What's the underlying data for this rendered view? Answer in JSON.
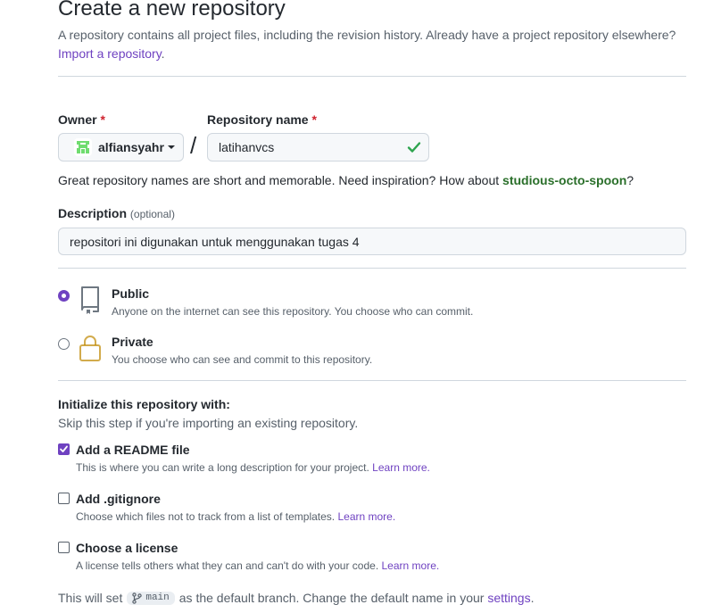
{
  "header": {
    "title": "Create a new repository",
    "subtitle": "A repository contains all project files, including the revision history. Already have a project repository elsewhere?",
    "import_link": "Import a repository",
    "import_link_suffix": "."
  },
  "owner": {
    "label": "Owner",
    "required_mark": "*",
    "value": "alfiansyahr"
  },
  "slash": "/",
  "repo_name": {
    "label": "Repository name",
    "required_mark": "*",
    "value": "latihanvcs"
  },
  "name_hint": {
    "text": "Great repository names are short and memorable. Need inspiration? How about ",
    "suggestion": "studious-octo-spoon",
    "suffix": "?"
  },
  "description": {
    "label": "Description",
    "optional": "(optional)",
    "value": "repositori ini digunakan untuk menggunakan tugas 4"
  },
  "visibility": {
    "selected": "public",
    "public": {
      "title": "Public",
      "desc": "Anyone on the internet can see this repository. You choose who can commit."
    },
    "private": {
      "title": "Private",
      "desc": "You choose who can see and commit to this repository."
    }
  },
  "init": {
    "title": "Initialize this repository with:",
    "subtitle": "Skip this step if you're importing an existing repository.",
    "readme": {
      "checked": true,
      "title": "Add a README file",
      "desc": "This is where you can write a long description for your project.",
      "link": "Learn more."
    },
    "gitignore": {
      "checked": false,
      "title": "Add .gitignore",
      "desc": "Choose which files not to track from a list of templates.",
      "link": "Learn more."
    },
    "license": {
      "checked": false,
      "title": "Choose a license",
      "desc": "A license tells others what they can and can't do with your code.",
      "link": "Learn more."
    }
  },
  "footer": {
    "prefix": "This will set",
    "branch": "main",
    "middle": "as the default branch. Change the default name in your",
    "link": "settings",
    "suffix": "."
  },
  "colors": {
    "accent": "#6f42c1",
    "success": "#2da44e",
    "required": "#cf222e",
    "suggestion": "#2a6f2a"
  }
}
